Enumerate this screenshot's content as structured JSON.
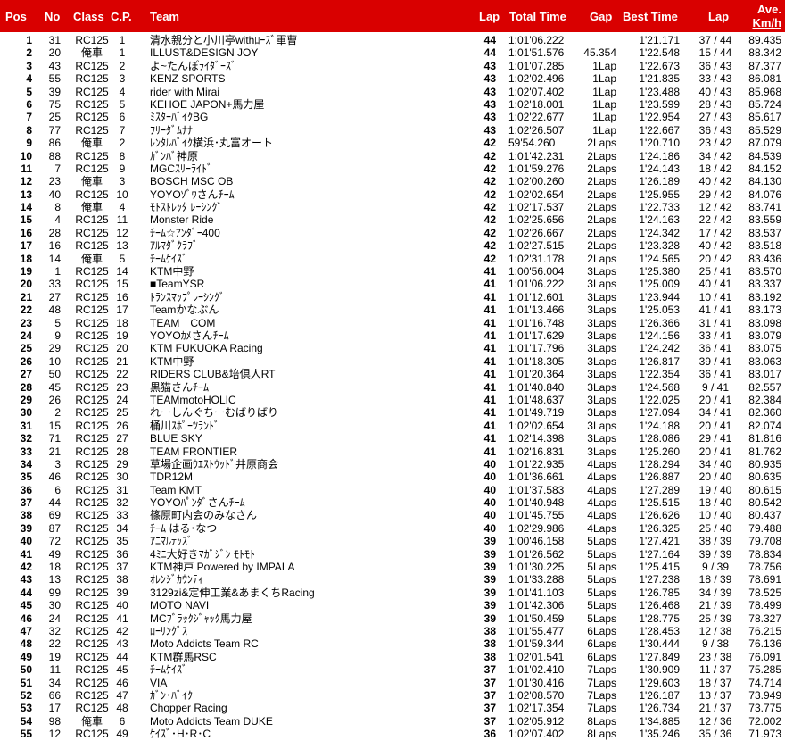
{
  "header": {
    "pos": "Pos",
    "no": "No",
    "class": "Class",
    "cp": "C.P.",
    "team": "Team",
    "lap": "Lap",
    "total": "Total Time",
    "gap": "Gap",
    "best": "Best Time",
    "lap2": "Lap",
    "ave_line1": "Ave.",
    "ave_line2": "Km/h"
  },
  "rows": [
    [
      "1",
      "31",
      "RC125",
      "1",
      "清水親分と小川亭withﾛｰｽﾞ軍曹",
      "44",
      "1:01'06.222",
      "",
      "1'21.171",
      "37 / 44",
      "89.435"
    ],
    [
      "2",
      "20",
      "俺車",
      "1",
      "ILLUST&DESIGN JOY",
      "44",
      "1:01'51.576",
      "45.354",
      "1'22.548",
      "15 / 44",
      "88.342"
    ],
    [
      "3",
      "43",
      "RC125",
      "2",
      "よ~たんぽﾗｲﾀﾞｰｽﾞ",
      "43",
      "1:01'07.285",
      "1Lap",
      "1'22.673",
      "36 / 43",
      "87.377"
    ],
    [
      "4",
      "55",
      "RC125",
      "3",
      "KENZ SPORTS",
      "43",
      "1:02'02.496",
      "1Lap",
      "1'21.835",
      "33 / 43",
      "86.081"
    ],
    [
      "5",
      "39",
      "RC125",
      "4",
      "rider with Mirai",
      "43",
      "1:02'07.402",
      "1Lap",
      "1'23.488",
      "40 / 43",
      "85.968"
    ],
    [
      "6",
      "75",
      "RC125",
      "5",
      "KEHOE JAPON+馬力屋",
      "43",
      "1:02'18.001",
      "1Lap",
      "1'23.599",
      "28 / 43",
      "85.724"
    ],
    [
      "7",
      "25",
      "RC125",
      "6",
      "ﾐｽﾀｰﾊﾞｲｸBG",
      "43",
      "1:02'22.677",
      "1Lap",
      "1'22.954",
      "27 / 43",
      "85.617"
    ],
    [
      "8",
      "77",
      "RC125",
      "7",
      "ﾌﾘｰﾀﾞﾑﾅﾅ",
      "43",
      "1:02'26.507",
      "1Lap",
      "1'22.667",
      "36 / 43",
      "85.529"
    ],
    [
      "9",
      "86",
      "俺車",
      "2",
      "ﾚﾝﾀﾙﾊﾞｲｸ横浜･丸富オート",
      "42",
      "59'54.260",
      "2Laps",
      "1'20.710",
      "23 / 42",
      "87.079"
    ],
    [
      "10",
      "88",
      "RC125",
      "8",
      "ｶﾞﾝﾊﾞ神原",
      "42",
      "1:01'42.231",
      "2Laps",
      "1'24.186",
      "34 / 42",
      "84.539"
    ],
    [
      "11",
      "7",
      "RC125",
      "9",
      "MGCｽﾘｰﾗｲﾄﾞ",
      "42",
      "1:01'59.276",
      "2Laps",
      "1'24.143",
      "18 / 42",
      "84.152"
    ],
    [
      "12",
      "23",
      "俺車",
      "3",
      "BOSCH MSC OB",
      "42",
      "1:02'00.260",
      "2Laps",
      "1'26.189",
      "40 / 42",
      "84.130"
    ],
    [
      "13",
      "40",
      "RC125",
      "10",
      "YOYOｿﾞｳさんﾁｰﾑ",
      "42",
      "1:02'02.654",
      "2Laps",
      "1'25.955",
      "29 / 42",
      "84.076"
    ],
    [
      "14",
      "8",
      "俺車",
      "4",
      "ﾓﾄｽﾄﾚｯﾀ ﾚｰｼﾝｸﾞ",
      "42",
      "1:02'17.537",
      "2Laps",
      "1'22.733",
      "12 / 42",
      "83.741"
    ],
    [
      "15",
      "4",
      "RC125",
      "11",
      "Monster Ride",
      "42",
      "1:02'25.656",
      "2Laps",
      "1'24.163",
      "22 / 42",
      "83.559"
    ],
    [
      "16",
      "28",
      "RC125",
      "12",
      "ﾁｰﾑ☆ｱﾝﾀﾞｰ400",
      "42",
      "1:02'26.667",
      "2Laps",
      "1'24.342",
      "17 / 42",
      "83.537"
    ],
    [
      "17",
      "16",
      "RC125",
      "13",
      "ｱﾙﾏﾀﾞｸﾗﾌﾞ",
      "42",
      "1:02'27.515",
      "2Laps",
      "1'23.328",
      "40 / 42",
      "83.518"
    ],
    [
      "18",
      "14",
      "俺車",
      "5",
      "ﾁｰﾑｹｲｽﾞ",
      "42",
      "1:02'31.178",
      "2Laps",
      "1'24.565",
      "20 / 42",
      "83.436"
    ],
    [
      "19",
      "1",
      "RC125",
      "14",
      "KTM中野",
      "41",
      "1:00'56.004",
      "3Laps",
      "1'25.380",
      "25 / 41",
      "83.570"
    ],
    [
      "20",
      "33",
      "RC125",
      "15",
      "■TeamYSR",
      "41",
      "1:01'06.222",
      "3Laps",
      "1'25.009",
      "40 / 41",
      "83.337"
    ],
    [
      "21",
      "27",
      "RC125",
      "16",
      "ﾄﾗﾝｽﾏｯﾌﾟﾚｰｼﾝｸﾞ",
      "41",
      "1:01'12.601",
      "3Laps",
      "1'23.944",
      "10 / 41",
      "83.192"
    ],
    [
      "22",
      "48",
      "RC125",
      "17",
      "Teamかなぶん",
      "41",
      "1:01'13.466",
      "3Laps",
      "1'25.053",
      "41 / 41",
      "83.173"
    ],
    [
      "23",
      "5",
      "RC125",
      "18",
      "TEAM　COM",
      "41",
      "1:01'16.748",
      "3Laps",
      "1'26.366",
      "31 / 41",
      "83.098"
    ],
    [
      "24",
      "9",
      "RC125",
      "19",
      "YOYOｶﾒさんﾁｰﾑ",
      "41",
      "1:01'17.629",
      "3Laps",
      "1'24.156",
      "33 / 41",
      "83.079"
    ],
    [
      "25",
      "29",
      "RC125",
      "20",
      "KTM FUKUOKA Racing",
      "41",
      "1:01'17.796",
      "3Laps",
      "1'24.242",
      "36 / 41",
      "83.075"
    ],
    [
      "26",
      "10",
      "RC125",
      "21",
      "KTM中野",
      "41",
      "1:01'18.305",
      "3Laps",
      "1'26.817",
      "39 / 41",
      "83.063"
    ],
    [
      "27",
      "50",
      "RC125",
      "22",
      "RIDERS CLUB&培倶人RT",
      "41",
      "1:01'20.364",
      "3Laps",
      "1'22.354",
      "36 / 41",
      "83.017"
    ],
    [
      "28",
      "45",
      "RC125",
      "23",
      "黒猫さんﾁｰﾑ",
      "41",
      "1:01'40.840",
      "3Laps",
      "1'24.568",
      "9 / 41",
      "82.557"
    ],
    [
      "29",
      "26",
      "RC125",
      "24",
      "TEAMmotoHOLIC",
      "41",
      "1:01'48.637",
      "3Laps",
      "1'22.025",
      "20 / 41",
      "82.384"
    ],
    [
      "30",
      "2",
      "RC125",
      "25",
      "れーしんぐちーむばりばり",
      "41",
      "1:01'49.719",
      "3Laps",
      "1'27.094",
      "34 / 41",
      "82.360"
    ],
    [
      "31",
      "15",
      "RC125",
      "26",
      "桶川ｽﾎﾟｰﾂﾗﾝﾄﾞ",
      "41",
      "1:02'02.654",
      "3Laps",
      "1'24.188",
      "20 / 41",
      "82.074"
    ],
    [
      "32",
      "71",
      "RC125",
      "27",
      "BLUE SKY",
      "41",
      "1:02'14.398",
      "3Laps",
      "1'28.086",
      "29 / 41",
      "81.816"
    ],
    [
      "33",
      "21",
      "RC125",
      "28",
      "TEAM FRONTIER",
      "41",
      "1:02'16.831",
      "3Laps",
      "1'25.260",
      "20 / 41",
      "81.762"
    ],
    [
      "34",
      "3",
      "RC125",
      "29",
      "草場企画ｳｴｽﾄｳｯﾄﾞ井原商会",
      "40",
      "1:01'22.935",
      "4Laps",
      "1'28.294",
      "34 / 40",
      "80.935"
    ],
    [
      "35",
      "46",
      "RC125",
      "30",
      "TDR12M",
      "40",
      "1:01'36.661",
      "4Laps",
      "1'26.887",
      "20 / 40",
      "80.635"
    ],
    [
      "36",
      "6",
      "RC125",
      "31",
      "Team KMT",
      "40",
      "1:01'37.583",
      "4Laps",
      "1'27.289",
      "19 / 40",
      "80.615"
    ],
    [
      "37",
      "44",
      "RC125",
      "32",
      "YOYOﾊﾟﾝﾀﾞさんﾁｰﾑ",
      "40",
      "1:01'40.948",
      "4Laps",
      "1'25.515",
      "18 / 40",
      "80.542"
    ],
    [
      "38",
      "69",
      "RC125",
      "33",
      "篠原町内会のみなさん",
      "40",
      "1:01'45.755",
      "4Laps",
      "1'26.626",
      "10 / 40",
      "80.437"
    ],
    [
      "39",
      "87",
      "RC125",
      "34",
      "ﾁｰﾑ はる･なつ",
      "40",
      "1:02'29.986",
      "4Laps",
      "1'26.325",
      "25 / 40",
      "79.488"
    ],
    [
      "40",
      "72",
      "RC125",
      "35",
      "ｱﾆﾏﾙﾃｯｽﾞ",
      "39",
      "1:00'46.158",
      "5Laps",
      "1'27.421",
      "38 / 39",
      "79.708"
    ],
    [
      "41",
      "49",
      "RC125",
      "36",
      "4ﾐﾆ大好きﾏｶﾞｼﾞﾝ ﾓﾄﾓﾄ",
      "39",
      "1:01'26.562",
      "5Laps",
      "1'27.164",
      "39 / 39",
      "78.834"
    ],
    [
      "42",
      "18",
      "RC125",
      "37",
      "KTM神戸 Powered by IMPALA",
      "39",
      "1:01'30.225",
      "5Laps",
      "1'25.415",
      "9 / 39",
      "78.756"
    ],
    [
      "43",
      "13",
      "RC125",
      "38",
      "ｵﾚﾝｼﾞｶｳﾝﾃｨ",
      "39",
      "1:01'33.288",
      "5Laps",
      "1'27.238",
      "18 / 39",
      "78.691"
    ],
    [
      "44",
      "99",
      "RC125",
      "39",
      "3129zi&定伸工業&あまくちRacing",
      "39",
      "1:01'41.103",
      "5Laps",
      "1'26.785",
      "34 / 39",
      "78.525"
    ],
    [
      "45",
      "30",
      "RC125",
      "40",
      "MOTO NAVI",
      "39",
      "1:01'42.306",
      "5Laps",
      "1'26.468",
      "21 / 39",
      "78.499"
    ],
    [
      "46",
      "24",
      "RC125",
      "41",
      "MCﾌﾞﾗｯｸｼﾞｬｯｸ馬力屋",
      "39",
      "1:01'50.459",
      "5Laps",
      "1'28.775",
      "25 / 39",
      "78.327"
    ],
    [
      "47",
      "32",
      "RC125",
      "42",
      "ﾛｰﾘﾝｸﾞｽ",
      "38",
      "1:01'55.477",
      "6Laps",
      "1'28.453",
      "12 / 38",
      "76.215"
    ],
    [
      "48",
      "22",
      "RC125",
      "43",
      "Moto Addicts Team RC",
      "38",
      "1:01'59.344",
      "6Laps",
      "1'30.444",
      "9 / 38",
      "76.136"
    ],
    [
      "49",
      "19",
      "RC125",
      "44",
      "KTM群馬RSC",
      "38",
      "1:02'01.541",
      "6Laps",
      "1'27.849",
      "23 / 38",
      "76.091"
    ],
    [
      "50",
      "11",
      "RC125",
      "45",
      "ﾁｰﾑｹｲｽﾞ",
      "37",
      "1:01'02.410",
      "7Laps",
      "1'30.909",
      "11 / 37",
      "75.285"
    ],
    [
      "51",
      "34",
      "RC125",
      "46",
      "VIA",
      "37",
      "1:01'30.416",
      "7Laps",
      "1'29.603",
      "18 / 37",
      "74.714"
    ],
    [
      "52",
      "66",
      "RC125",
      "47",
      "ｶﾞﾝ･ﾊﾞｲｸ",
      "37",
      "1:02'08.570",
      "7Laps",
      "1'26.187",
      "13 / 37",
      "73.949"
    ],
    [
      "53",
      "17",
      "RC125",
      "48",
      "Chopper Racing",
      "37",
      "1:02'17.354",
      "7Laps",
      "1'26.734",
      "21 / 37",
      "73.775"
    ],
    [
      "54",
      "98",
      "俺車",
      "6",
      "Moto Addicts Team DUKE",
      "37",
      "1:02'05.912",
      "8Laps",
      "1'34.885",
      "12 / 36",
      "72.002"
    ],
    [
      "55",
      "12",
      "RC125",
      "49",
      "ｹｲｽﾞ･H･R･C",
      "36",
      "1:02'07.402",
      "8Laps",
      "1'35.246",
      "35 / 36",
      "71.973"
    ]
  ]
}
